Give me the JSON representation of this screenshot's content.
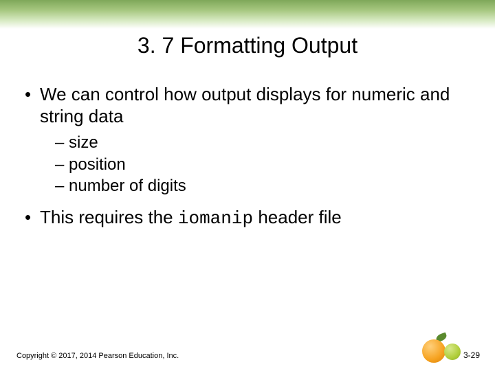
{
  "title": "3. 7 Formatting Output",
  "bullets": [
    {
      "text": "We can control how output displays for numeric and string data",
      "sub": [
        "size",
        "position",
        "number of digits"
      ]
    },
    {
      "prefix": "This requires the ",
      "code": "iomanip",
      "suffix": " header file"
    }
  ],
  "footer": {
    "copyright": "Copyright © 2017, 2014 Pearson Education, Inc.",
    "page": "3-29"
  }
}
